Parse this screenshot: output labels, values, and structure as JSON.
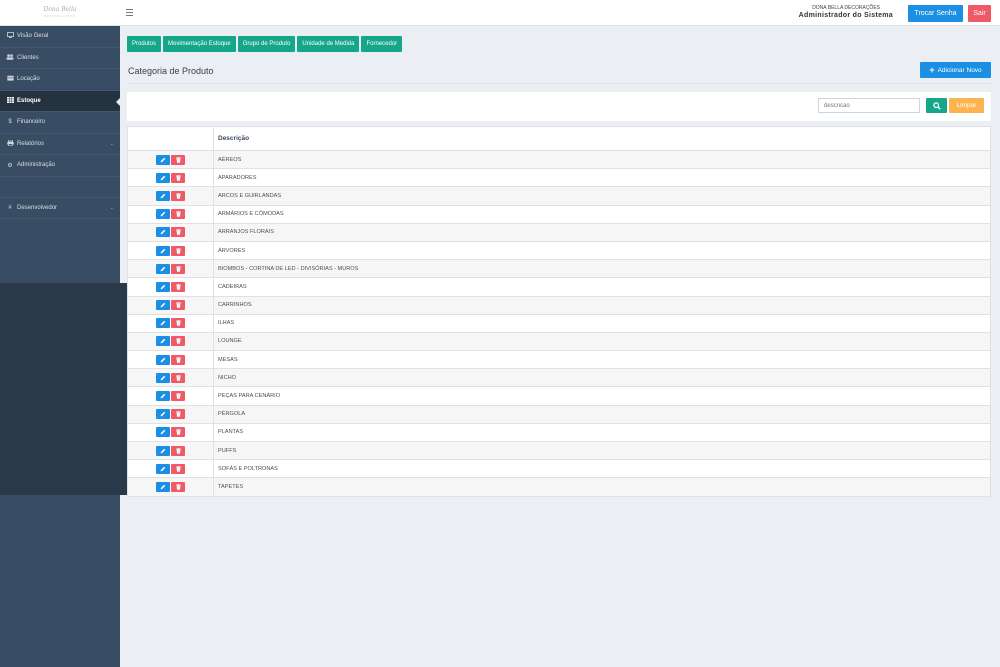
{
  "header": {
    "logo_text": "Dona Bella",
    "logo_subtext": "DECORAÇÕES",
    "company": "DONA BELLA DECORAÇÕES",
    "user_role": "Administrador do Sistema",
    "change_password_label": "Trocar Senha",
    "logout_label": "Sair"
  },
  "sidebar": {
    "items": [
      {
        "label": "Visão Geral",
        "icon": "monitor-icon"
      },
      {
        "label": "Clientes",
        "icon": "users-icon"
      },
      {
        "label": "Locação",
        "icon": "box-icon"
      },
      {
        "label": "Estoque",
        "icon": "grid-icon"
      },
      {
        "label": "Financeiro",
        "icon": "dollar-icon"
      },
      {
        "label": "Relatórios",
        "icon": "printer-icon"
      },
      {
        "label": "Administração",
        "icon": "cog-icon"
      },
      {
        "label": "Desenvolvedor",
        "icon": "hash-icon"
      }
    ]
  },
  "tabs": [
    {
      "label": "Produtos"
    },
    {
      "label": "Movimentação Estoque"
    },
    {
      "label": "Grupo de Produto"
    },
    {
      "label": "Unidade de Medida"
    },
    {
      "label": "Fornecedor"
    }
  ],
  "page": {
    "title": "Categoria de Produto",
    "add_label": "Adicionar Novo"
  },
  "filter": {
    "placeholder": "descricao",
    "clear_label": "Limpar"
  },
  "table": {
    "columns": [
      "",
      "Descrição"
    ],
    "rows": [
      "AÉREOS",
      "APARADORES",
      "ARCOS E GUIRLANDAS",
      "ARMÁRIOS E CÔMODAS",
      "ARRANJOS FLORAIS",
      "ÁRVORES",
      "BIOMBOS - CORTINA DE LED - DIVISÓRIAS - MUROS",
      "CADEIRAS",
      "CARRINHOS",
      "ILHAS",
      "LOUNGE",
      "MESAS",
      "NICHO",
      "PEÇAS PARA CENÁRIO",
      "PÉRGOLA",
      "PLANTAS",
      "PUFFS",
      "SOFÁS E POLTRONAS",
      "TAPETES"
    ]
  },
  "colors": {
    "primary": "#1a8fe3",
    "success": "#16a78a",
    "danger": "#f05a66",
    "warning": "#fbb450",
    "sidebar": "#384d63"
  }
}
